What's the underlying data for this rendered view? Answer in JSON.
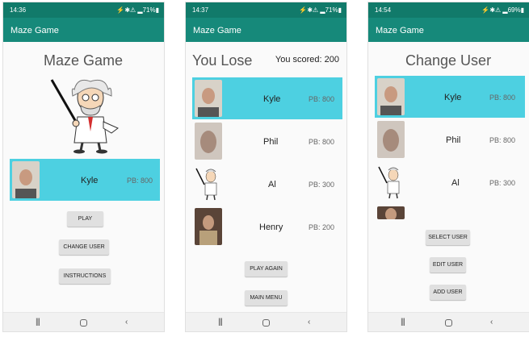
{
  "status": {
    "p1": {
      "time": "14:36",
      "icons": "⚡✱⚠ ▂71%▮"
    },
    "p2": {
      "time": "14:37",
      "icons": "⚡✱⚠ ▂71%▮"
    },
    "p3": {
      "time": "14:54",
      "icons": "⚡✱⚠ ▂69%▮"
    }
  },
  "app_title": "Maze Game",
  "screen1": {
    "title": "Maze Game",
    "user": {
      "name": "Kyle",
      "pb": "PB: 800"
    },
    "buttons": {
      "play": "PLAY",
      "change_user": "CHANGE USER",
      "instructions": "INSTRUCTIONS"
    }
  },
  "screen2": {
    "title": "You Lose",
    "score": "You scored: 200",
    "users": [
      {
        "name": "Kyle",
        "pb": "PB: 800"
      },
      {
        "name": "Phil",
        "pb": "PB: 800"
      },
      {
        "name": "Al",
        "pb": "PB: 300"
      },
      {
        "name": "Henry",
        "pb": "PB: 200"
      }
    ],
    "buttons": {
      "play_again": "PLAY AGAIN",
      "main_menu": "MAIN MENU"
    }
  },
  "screen3": {
    "title": "Change User",
    "users": [
      {
        "name": "Kyle",
        "pb": "PB: 800"
      },
      {
        "name": "Phil",
        "pb": "PB: 800"
      },
      {
        "name": "Al",
        "pb": "PB: 300"
      }
    ],
    "buttons": {
      "select_user": "SELECT USER",
      "edit_user": "EDIT USER",
      "add_user": "ADD USER"
    }
  },
  "nav": {
    "recent": "|||",
    "back": "‹"
  },
  "colors": {
    "status_bar": "#117a6a",
    "app_bar": "#16897a",
    "selected_row": "#4dd0e1"
  }
}
